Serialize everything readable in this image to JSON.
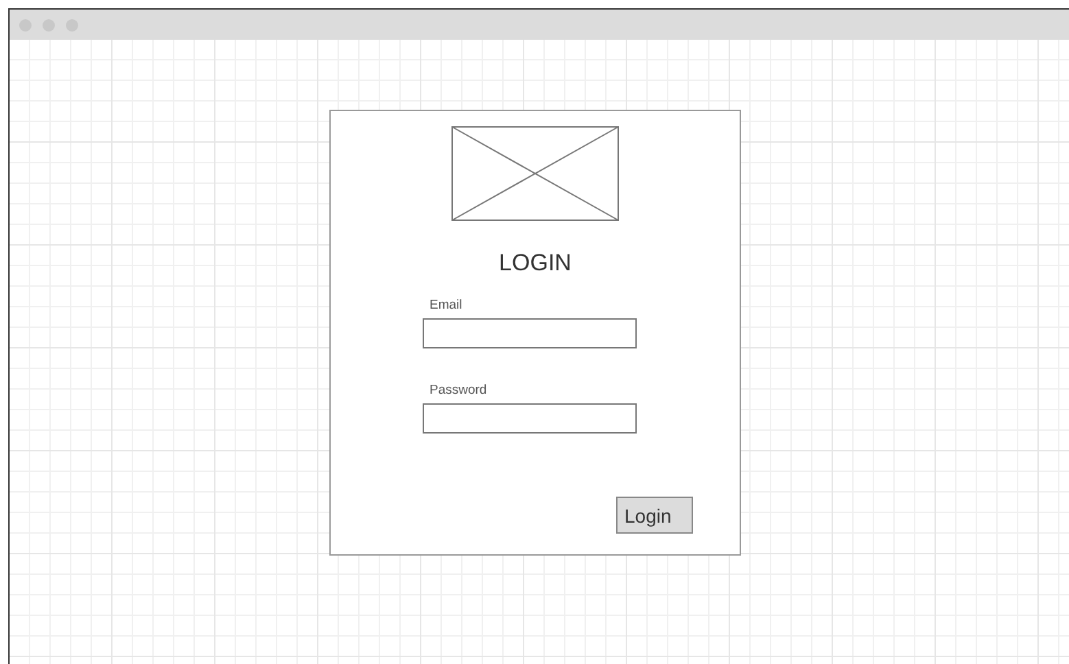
{
  "form": {
    "heading": "LOGIN",
    "fields": [
      {
        "label": "Email"
      },
      {
        "label": "Password"
      }
    ],
    "submit": "Login"
  }
}
